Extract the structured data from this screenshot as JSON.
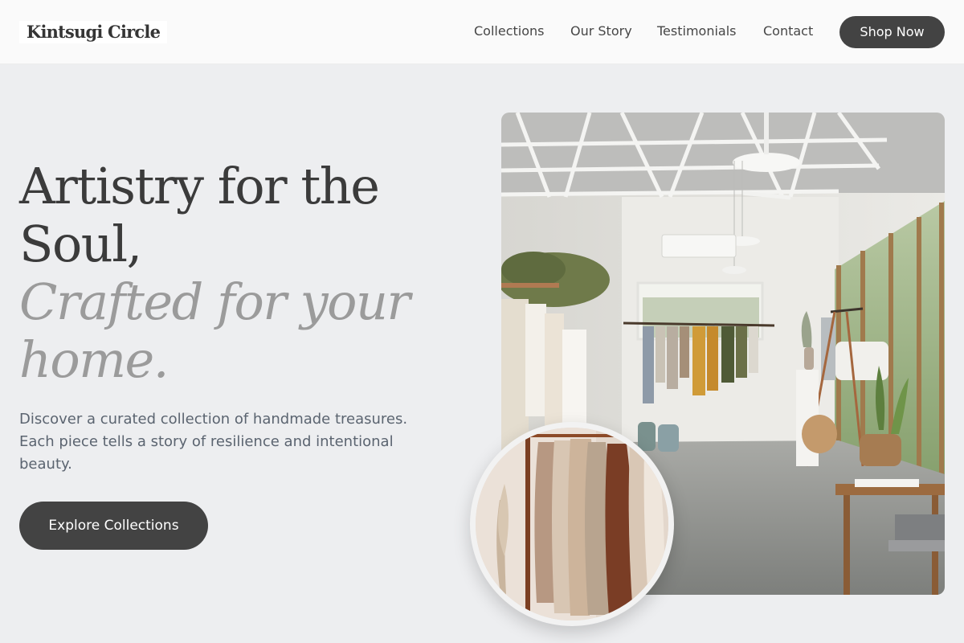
{
  "brand": {
    "name": "Kintsugi Circle"
  },
  "nav": {
    "links": [
      "Collections",
      "Our Story",
      "Testimonials",
      "Contact"
    ],
    "cta_label": "Shop Now"
  },
  "hero": {
    "headline_line1": "Artistry for the",
    "headline_line2": "Soul,",
    "accent_line1": "Crafted for your",
    "accent_line2": "home.",
    "description": "Discover a curated collection of handmade treasures. Each piece tells a story of resilience and intentional beauty.",
    "button_label": "Explore Collections"
  },
  "colors": {
    "page_bg": "#edeef0",
    "header_bg": "#fafafa",
    "button_bg": "#434343",
    "headline": "#3b3b3b",
    "accent": "#9b9b9b",
    "body_text": "#5b6470"
  }
}
